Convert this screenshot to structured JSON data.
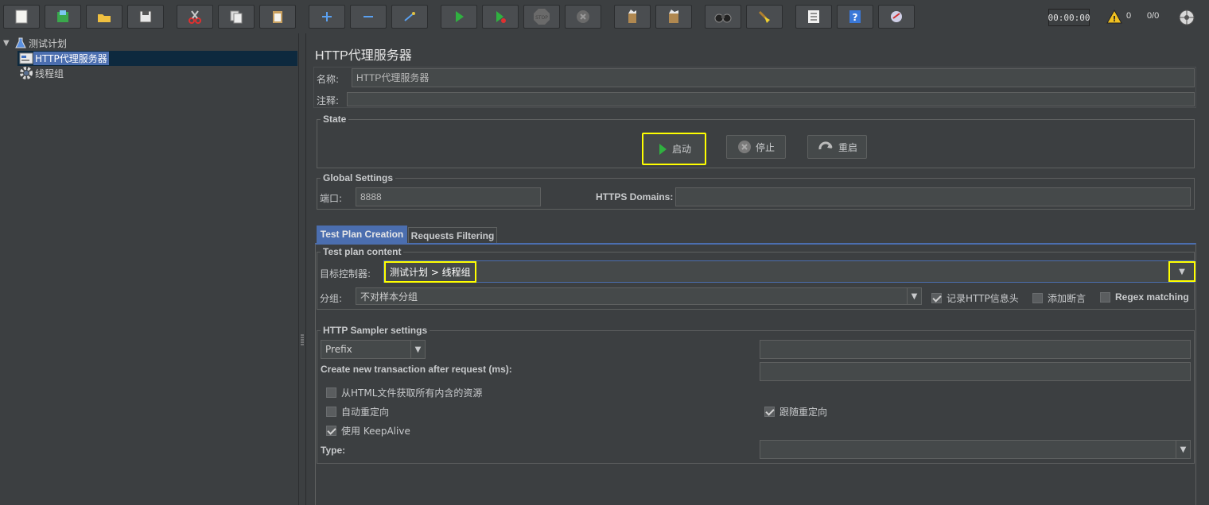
{
  "toolbar": {
    "icons": [
      "new-icon",
      "templates-icon",
      "open-icon",
      "save-icon",
      "cut-icon",
      "copy-icon",
      "paste-icon",
      "expand-icon",
      "collapse-icon",
      "toggle-icon",
      "start-icon",
      "start-no-pause-icon",
      "stop-icon",
      "shutdown-icon",
      "clear-icon",
      "clear-all-icon",
      "search-icon",
      "reset-search-icon",
      "function-helper-icon",
      "help-icon",
      "remote-icon"
    ],
    "timer": "00:00:00",
    "warning_count": "0",
    "thread_count": "0/0"
  },
  "tree": {
    "items": [
      {
        "label": "测试计划",
        "icon": "flask-icon"
      },
      {
        "label": "HTTP代理服务器",
        "icon": "proxy-icon"
      },
      {
        "label": "线程组",
        "icon": "gear-icon"
      }
    ]
  },
  "main": {
    "title": "HTTP代理服务器",
    "name_label": "名称:",
    "name_value": "HTTP代理服务器",
    "comment_label": "注释:",
    "comment_value": "",
    "state": {
      "title": "State",
      "start_label": "启动",
      "stop_label": "停止",
      "restart_label": "重启"
    },
    "global": {
      "title": "Global Settings",
      "port_label": "端口:",
      "port_value": "8888",
      "https_label": "HTTPS Domains:",
      "https_value": ""
    },
    "tabs": [
      {
        "label": "Test Plan Creation",
        "active": true
      },
      {
        "label": "Requests Filtering",
        "active": false
      }
    ],
    "content": {
      "title": "Test plan content",
      "target_label": "目标控制器:",
      "target_value": "测试计划 > 线程组",
      "group_label": "分组:",
      "group_value": "不对样本分组",
      "record_headers_label": "记录HTTP信息头",
      "record_headers_checked": true,
      "add_assertions_label": "添加断言",
      "add_assertions_checked": false,
      "regex_label": "Regex matching",
      "regex_checked": false
    },
    "sampler": {
      "title": "HTTP Sampler settings",
      "prefix_value": "Prefix",
      "prefix_input": "",
      "transaction_label": "Create new transaction after request (ms):",
      "transaction_value": "",
      "retrieve_label": "从HTML文件获取所有内含的资源",
      "retrieve_checked": false,
      "auto_redirect_label": "自动重定向",
      "auto_redirect_checked": false,
      "follow_redirect_label": "跟随重定向",
      "follow_redirect_checked": true,
      "keepalive_label": "使用 KeepAlive",
      "keepalive_checked": true,
      "type_label": "Type:",
      "type_value": ""
    }
  },
  "colors": {
    "background": "#3c3f41",
    "selection": "#4b6eaf",
    "highlight": "#ffff00",
    "input": "#45494a"
  }
}
